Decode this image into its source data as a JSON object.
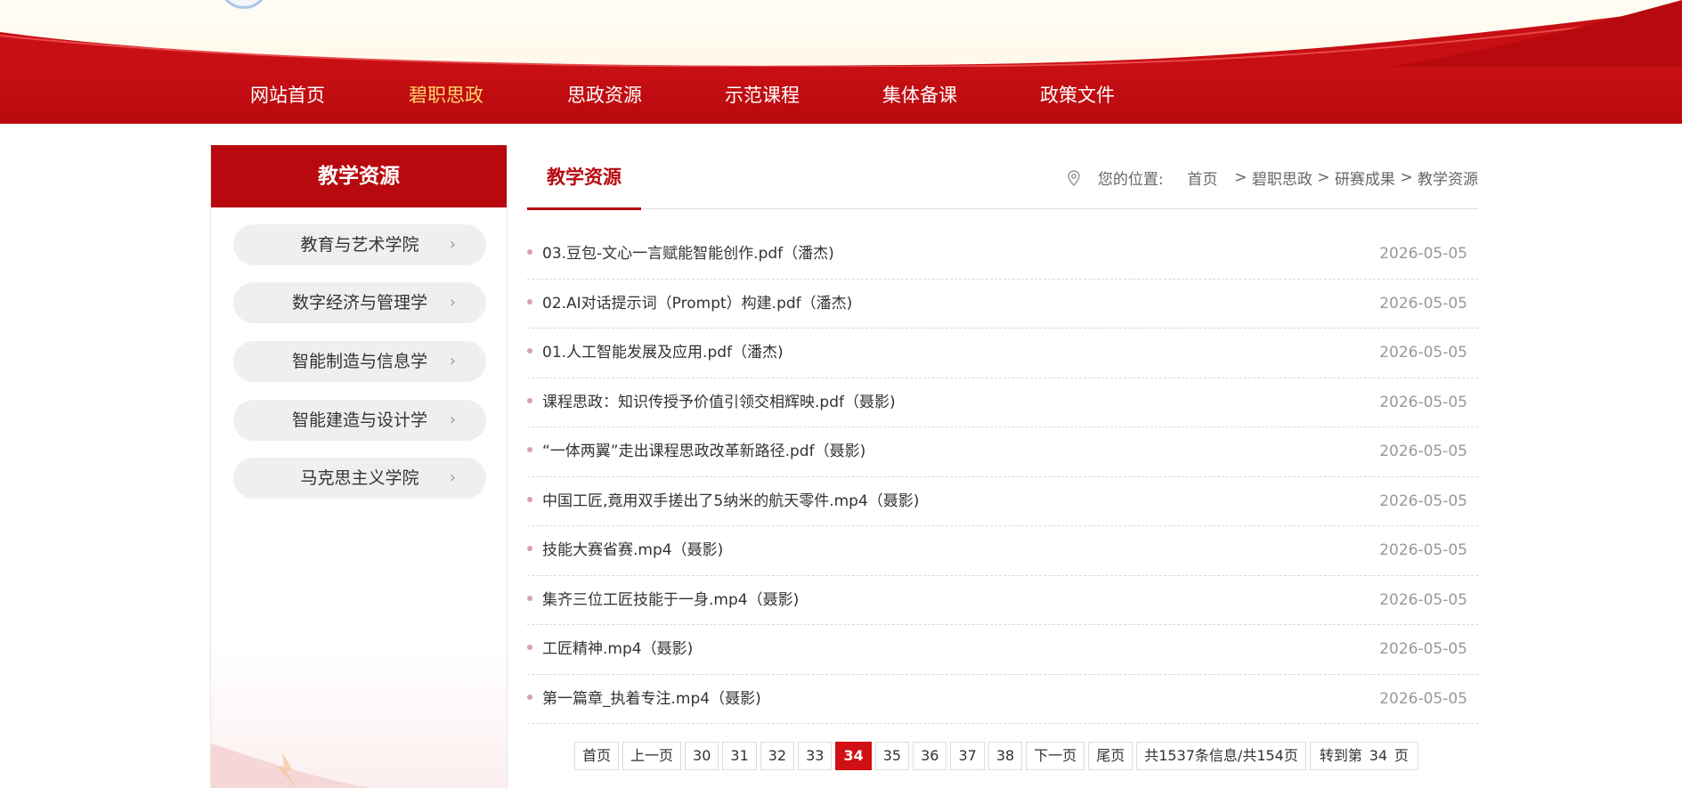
{
  "nav": {
    "items": [
      {
        "label": "网站首页",
        "active": false
      },
      {
        "label": "碧职思政",
        "active": true
      },
      {
        "label": "思政资源",
        "active": false
      },
      {
        "label": "示范课程",
        "active": false
      },
      {
        "label": "集体备课",
        "active": false
      },
      {
        "label": "政策文件",
        "active": false
      }
    ]
  },
  "sidebar": {
    "title": "教学资源",
    "items": [
      {
        "label": "教育与艺术学院"
      },
      {
        "label": "数字经济与管理学"
      },
      {
        "label": "智能制造与信息学"
      },
      {
        "label": "智能建造与设计学"
      },
      {
        "label": "马克思主义学院"
      }
    ]
  },
  "content": {
    "title": "教学资源",
    "breadcrumb": {
      "prefix": "您的位置:",
      "items": [
        "首页",
        "碧职思政",
        "研赛成果",
        "教学资源"
      ],
      "separator": ">"
    },
    "rows": [
      {
        "title": "03.豆包-文心一言赋能智能创作.pdf（潘杰)",
        "date": "2026-05-05"
      },
      {
        "title": "02.AI对话提示词（Prompt）构建.pdf（潘杰)",
        "date": "2026-05-05"
      },
      {
        "title": "01.人工智能发展及应用.pdf（潘杰)",
        "date": "2026-05-05"
      },
      {
        "title": "课程思政：知识传授予价值引领交相辉映.pdf（聂影)",
        "date": "2026-05-05"
      },
      {
        "title": "“一体两翼”走出课程思政改革新路径.pdf（聂影)",
        "date": "2026-05-05"
      },
      {
        "title": "中国工匠,竟用双手搓出了5纳米的航天零件.mp4（聂影)",
        "date": "2026-05-05"
      },
      {
        "title": "技能大赛省赛.mp4（聂影)",
        "date": "2026-05-05"
      },
      {
        "title": "集齐三位工匠技能于一身.mp4（聂影)",
        "date": "2026-05-05"
      },
      {
        "title": "工匠精神.mp4（聂影)",
        "date": "2026-05-05"
      },
      {
        "title": "第一篇章_执着专注.mp4（聂影)",
        "date": "2026-05-05"
      }
    ]
  },
  "pagination": {
    "first": "首页",
    "prev": "上一页",
    "pages": [
      "30",
      "31",
      "32",
      "33",
      "34",
      "35",
      "36",
      "37",
      "38"
    ],
    "current": "34",
    "next": "下一页",
    "last": "尾页",
    "info": "共1537条信息/共154页",
    "goto_prefix": "转到第",
    "goto_value": "34",
    "goto_suffix": "页"
  },
  "colors": {
    "brand_red": "#b80a0e",
    "active_nav": "#ffd56a",
    "current_page": "#d10f15"
  }
}
